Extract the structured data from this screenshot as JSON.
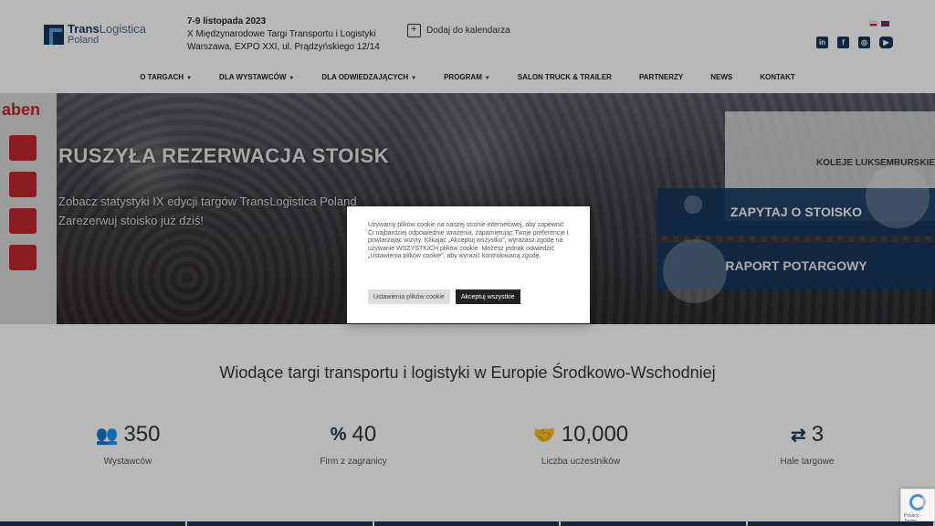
{
  "header": {
    "logo_line1_bold": "Trans",
    "logo_line1_light": "Logistica",
    "logo_line2": "Poland",
    "event_date": "7-9 listopada 2023",
    "event_name": "X Międzynarodowe Targi Transportu i Logistyki",
    "event_location": "Warszawa, EXPO XXI, ul. Prądzyńskiego 12/14",
    "calendar_label": "Dodaj do kalendarza"
  },
  "nav": {
    "items": [
      {
        "label": "O TARGACH",
        "dropdown": true
      },
      {
        "label": "DLA WYSTAWCÓW",
        "dropdown": true
      },
      {
        "label": "DLA ODWIEDZAJĄCYCH",
        "dropdown": true
      },
      {
        "label": "PROGRAM",
        "dropdown": true
      },
      {
        "label": "SALON TRUCK & TRAILER",
        "dropdown": false
      },
      {
        "label": "PARTNERZY",
        "dropdown": false
      },
      {
        "label": "NEWS",
        "dropdown": false
      },
      {
        "label": "KONTAKT",
        "dropdown": false
      }
    ]
  },
  "social": [
    "in",
    "f",
    "ig",
    "yt"
  ],
  "hero": {
    "title": "RUSZYŁA REZERWACJA STOISK",
    "subtitle_line1": "Zobacz statystyki IX edycji targów TransLogistica Poland",
    "subtitle_line2": "Zarezerwuj stoisko już dziś!",
    "booth_text_1": "aben",
    "booth_text_2": "KOLEJE LUKSEMBURSKIE",
    "cta_booth": "ZAPYTAJ O STOISKO",
    "cta_report": "RAPORT POTARGOWY"
  },
  "cookie": {
    "text": "Używamy plików cookie na naszej stronie internetowej, aby zapewnić Ci najbardziej odpowiednie wrażenia, zapamiętując Twoje preferencje i powtarzając wizyty. Klikając „Akceptuj wszystko”, wyrażasz zgodę na używanie WSZYSTKICH plików cookie. Możesz jednak odwiedzić „Ustawienia plików cookie”, aby wyrazić kontrolowaną zgodę.",
    "settings_label": "Ustawienia plików cookie",
    "accept_label": "Akceptuj wszystkie"
  },
  "stats": {
    "title": "Wiodące targi transportu i logistyki w Europie Środkowo-Wschodniej",
    "items": [
      {
        "icon": "users-icon",
        "value": "350",
        "label": "Wystawców"
      },
      {
        "icon": "percent-icon",
        "value": "40",
        "label": "Firm z zagranicy"
      },
      {
        "icon": "handshake-icon",
        "value": "10,000",
        "label": "Liczba uczestników"
      },
      {
        "icon": "exchange-icon",
        "value": "3",
        "label": "Hale targowe"
      }
    ]
  },
  "recaptcha": {
    "text": "Privacy - Terms"
  },
  "colors": {
    "brand": "#17375e",
    "accent": "#4fa3d9",
    "dark_button": "#222222"
  }
}
